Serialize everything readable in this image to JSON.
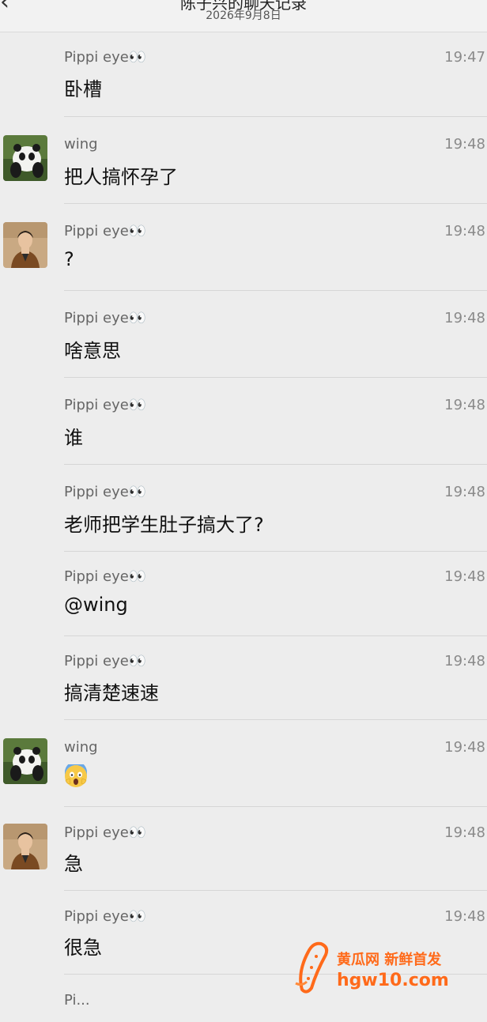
{
  "header": {
    "title": "陈子兴的聊天记录",
    "subtitle": "2026年9月8日"
  },
  "messages": [
    {
      "sender": "Pippi eye👀",
      "time": "19:47",
      "text": "卧槽",
      "avatar": "none"
    },
    {
      "sender": "wing",
      "time": "19:48",
      "text": "把人搞怀孕了",
      "avatar": "panda"
    },
    {
      "sender": "Pippi eye👀",
      "time": "19:48",
      "text": "?",
      "avatar": "person"
    },
    {
      "sender": "Pippi eye👀",
      "time": "19:48",
      "text": "啥意思",
      "avatar": "none"
    },
    {
      "sender": "Pippi eye👀",
      "time": "19:48",
      "text": "谁",
      "avatar": "none"
    },
    {
      "sender": "Pippi eye👀",
      "time": "19:48",
      "text": "老师把学生肚子搞大了?",
      "avatar": "none"
    },
    {
      "sender": "Pippi eye👀",
      "time": "19:48",
      "text": "@wing",
      "avatar": "none"
    },
    {
      "sender": "Pippi eye👀",
      "time": "19:48",
      "text": "搞清楚速速",
      "avatar": "none"
    },
    {
      "sender": "wing",
      "time": "19:48",
      "text": "",
      "avatar": "panda",
      "emoji": "screaming-face"
    },
    {
      "sender": "Pippi eye👀",
      "time": "19:48",
      "text": "急",
      "avatar": "person"
    },
    {
      "sender": "Pippi eye👀",
      "time": "19:48",
      "text": "很急",
      "avatar": "none"
    },
    {
      "sender": "Pi...",
      "time": "",
      "text": "",
      "avatar": "none"
    }
  ],
  "watermark": {
    "top": "黄瓜网 新鲜首发",
    "bottom": "hgw10.com"
  },
  "colors": {
    "background": "#ededed",
    "watermark": "#ff6a1a"
  },
  "icons": {
    "back": "chevron-left-icon",
    "more": "more-dots-icon"
  }
}
